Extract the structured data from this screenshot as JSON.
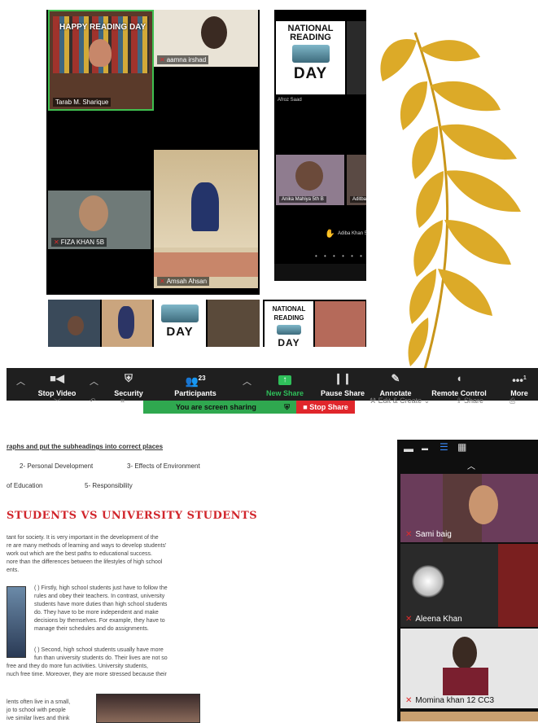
{
  "meeting_grid": {
    "tiles": [
      {
        "name": "Tarab M. Sharique"
      },
      {
        "name": "aamna irshad"
      },
      {
        "name": "FIZA KHAN 5B"
      },
      {
        "name": "Amsah Ahsan"
      }
    ],
    "banner": "HAPPY READING DAY"
  },
  "phone_view": {
    "poster_line1": "NATIONAL",
    "poster_line2": "READING",
    "poster_line3": "DAY",
    "poster_owner": "Afroz Saad",
    "tile_a": "Anika Mahiya 5th B",
    "tile_b": "Aditba",
    "raised_name": "Adiba Khan 5"
  },
  "bottom_strip": {
    "poster_day": "DAY",
    "poster_national": "NATIONAL",
    "poster_reading": "READING",
    "poster_day2": "DAY"
  },
  "toolbar": {
    "participants_count": "23",
    "stop_video": "Stop Video",
    "security": "Security",
    "participants": "Participants",
    "new_share": "New Share",
    "pause_share": "Pause Share",
    "annotate": "Annotate",
    "remote_control": "Remote Control",
    "more": "More",
    "more_badge": "1"
  },
  "sharing_bar": {
    "status": "You are screen sharing",
    "stop": "Stop Share"
  },
  "behind_toolbar": {
    "edit_create": "Edit & Create",
    "share": "Share"
  },
  "document": {
    "instruction": "raphs and put the subheadings into correct places",
    "opt2": "2- Personal Development",
    "opt3": "3- Effects of Environment",
    "opt_edu": "of Education",
    "opt5": "5- Responsibility",
    "title": "STUDENTS VS UNIVERSITY STUDENTS",
    "intro": [
      "tant for society. It is very important in the development of the",
      "re are many methods of learning and ways to develop students'",
      "work out which are the best paths to educational success.",
      "nore than the differences between the lifestyles of high school",
      "ents."
    ],
    "para1": [
      "(    ) Firstly, high school students just have to follow the",
      "rules and obey their teachers. In contrast, university",
      "students have more duties than high school students",
      "do. They have to be more independent and make",
      "decisions by themselves. For example, they have to",
      "manage their schedules and do assignments."
    ],
    "para2": [
      "(    ) Second, high school students usually have more",
      "fun than university students do. Their lives are not so",
      "free and they do more fun activities. University students,",
      "nuch free time. Moreover, they are more stressed because their"
    ],
    "para3": [
      "lents often live in a small,",
      "jo to school with people",
      "ive similar lives and think"
    ]
  },
  "participants_panel": {
    "people": [
      {
        "name": "Sami baig"
      },
      {
        "name": "Aleena Khan"
      },
      {
        "name": "Momina khan 12 CC3"
      }
    ]
  },
  "colors": {
    "toolbar_bg": "#1f1f1f",
    "new_share_green": "#2fa84f",
    "stop_red": "#e0262b",
    "doc_heading_red": "#d1262c",
    "leaf_gold": "#d9a520"
  }
}
